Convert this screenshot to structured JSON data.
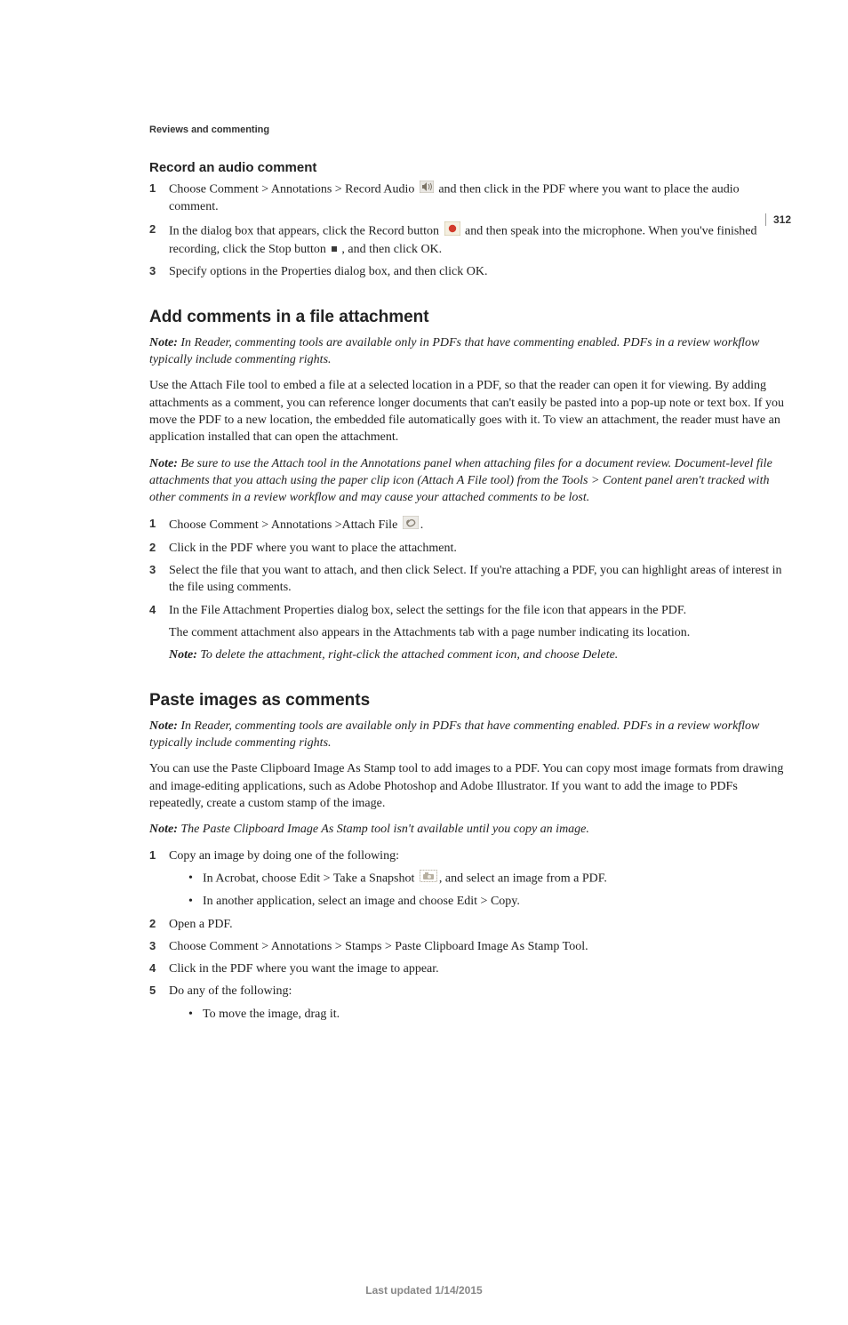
{
  "page_number": "312",
  "running_head": "Reviews and commenting",
  "s1": {
    "heading": "Record an audio comment",
    "step1_a": "Choose Comment > Annotations > Record Audio ",
    "step1_b": " and then click in the PDF where you want to place the audio comment.",
    "step2_a": "In the dialog box that appears, click the Record button ",
    "step2_b": " and then speak into the microphone. When you've finished recording, click the Stop button ",
    "step2_c": ", and then click OK.",
    "step3": "Specify options in the Properties dialog box, and then click OK."
  },
  "s2": {
    "heading": "Add comments in a file attachment",
    "note1_label": "Note: ",
    "note1": "In Reader, commenting tools are available only in PDFs that have commenting enabled. PDFs in a review workflow typically include commenting rights.",
    "para1": "Use the Attach File tool to embed a file at a selected location in a PDF, so that the reader can open it for viewing. By adding attachments as a comment, you can reference longer documents that can't easily be pasted into a pop-up note or text box. If you move the PDF to a new location, the embedded file automatically goes with it. To view an attachment, the reader must have an application installed that can open the attachment.",
    "note2_label": "Note: ",
    "note2": "Be sure to use the Attach tool in the Annotations panel when attaching files for a document review. Document-level file attachments that you attach using the paper clip icon (Attach A File tool) from the Tools > Content panel aren't tracked with other comments in a review workflow and may cause your attached comments to be lost.",
    "step1_a": "Choose Comment > Annotations >Attach File ",
    "step1_b": ".",
    "step2": "Click in the PDF where you want to place the attachment.",
    "step3": "Select the file that you want to attach, and then click Select. If you're attaching a PDF, you can highlight areas of interest in the file using comments.",
    "step4": "In the File Attachment Properties dialog box, select the settings for the file icon that appears in the PDF.",
    "step4_p1": "The comment attachment also appears in the Attachments tab with a page number indicating its location.",
    "step4_note_label": "Note: ",
    "step4_note": "To delete the attachment, right-click the attached comment icon, and choose Delete."
  },
  "s3": {
    "heading": "Paste images as comments",
    "note1_label": "Note: ",
    "note1": "In Reader, commenting tools are available only in PDFs that have commenting enabled. PDFs in a review workflow typically include commenting rights.",
    "para1": "You can use the Paste Clipboard Image As Stamp tool to add images to a PDF. You can copy most image formats from drawing and image-editing applications, such as Adobe Photoshop and Adobe Illustrator. If you want to add the image to PDFs repeatedly, create a custom stamp of the image.",
    "note2_label": "Note: ",
    "note2": "The Paste Clipboard Image As Stamp tool isn't available until you copy an image.",
    "step1": "Copy an image by doing one of the following:",
    "step1_b1_a": "In Acrobat, choose Edit > Take a Snapshot ",
    "step1_b1_b": ", and select an image from a PDF.",
    "step1_b2": "In another application, select an image and choose Edit > Copy.",
    "step2": "Open a PDF.",
    "step3": "Choose Comment > Annotations > Stamps > Paste Clipboard Image As Stamp Tool.",
    "step4": "Click in the PDF where you want the image to appear.",
    "step5": "Do any of the following:",
    "step5_b1": "To move the image, drag it."
  },
  "footer": "Last updated 1/14/2015"
}
